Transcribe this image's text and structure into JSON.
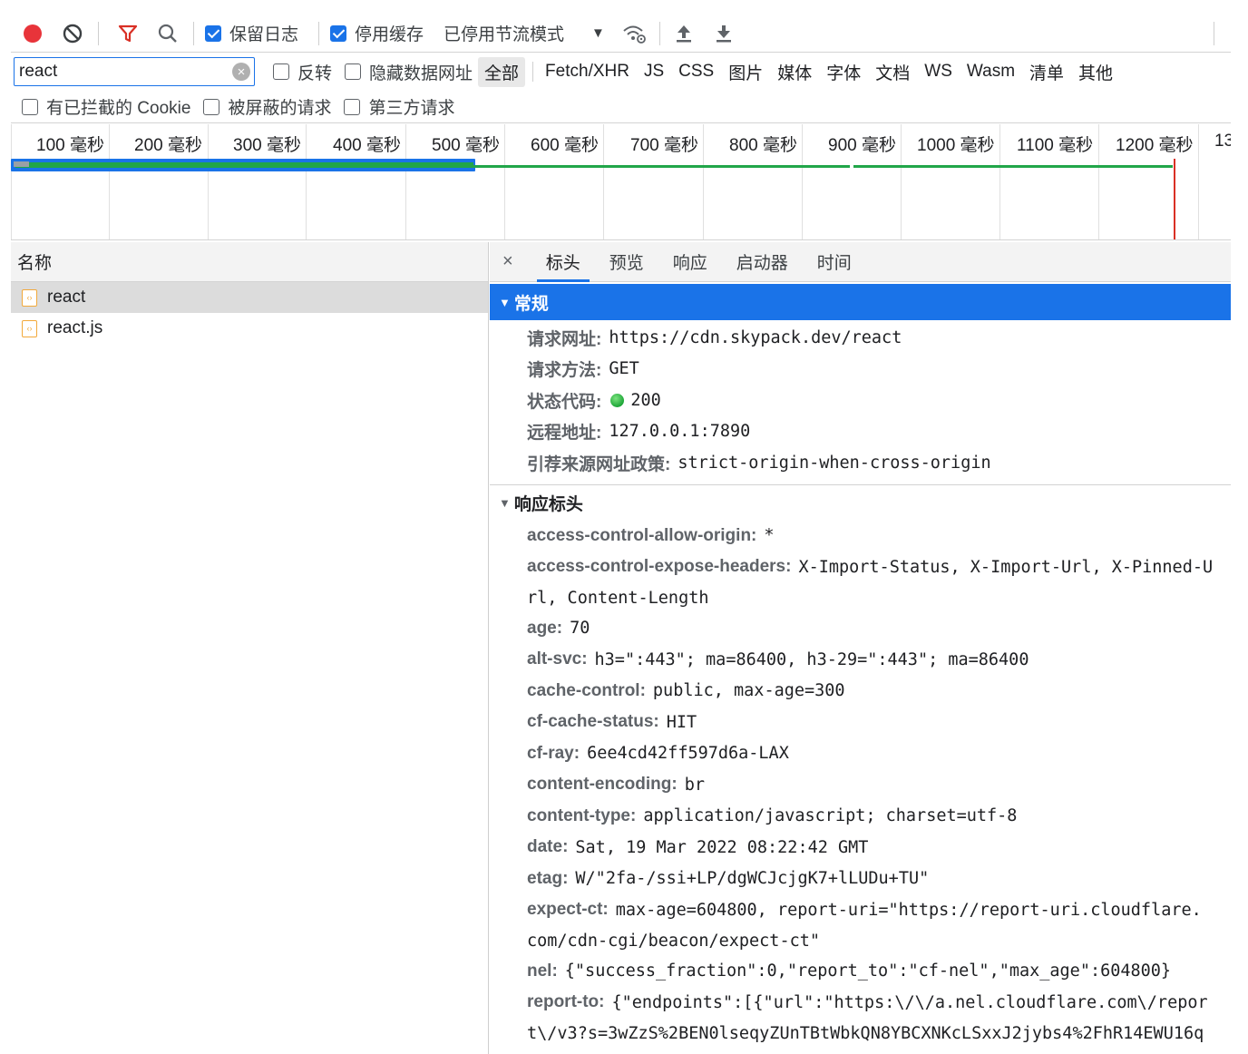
{
  "toolbar": {
    "preserve_log_label": "保留日志",
    "preserve_log_checked": true,
    "disable_cache_label": "停用缓存",
    "disable_cache_checked": true,
    "throttle_value": "已停用节流模式"
  },
  "filter": {
    "query": "react",
    "invert_label": "反转",
    "hide_data_urls_label": "隐藏数据网址",
    "types": [
      "全部",
      "Fetch/XHR",
      "JS",
      "CSS",
      "图片",
      "媒体",
      "字体",
      "文档",
      "WS",
      "Wasm",
      "清单",
      "其他"
    ],
    "active_type": "全部",
    "blocked_cookies_label": "有已拦截的 Cookie",
    "blocked_requests_label": "被屏蔽的请求",
    "third_party_label": "第三方请求"
  },
  "timeline": {
    "ticks": [
      "100 毫秒",
      "200 毫秒",
      "300 毫秒",
      "400 毫秒",
      "500 毫秒",
      "600 毫秒",
      "700 毫秒",
      "800 毫秒",
      "900 毫秒",
      "1000 毫秒",
      "1100 毫秒",
      "1200 毫秒",
      "13"
    ]
  },
  "requests": {
    "column_name": "名称",
    "items": [
      {
        "name": "react",
        "selected": true
      },
      {
        "name": "react.js",
        "selected": false
      }
    ]
  },
  "details": {
    "close": "×",
    "tabs": [
      "标头",
      "预览",
      "响应",
      "启动器",
      "时间"
    ],
    "active_tab": "标头",
    "general": {
      "title": "常规",
      "rows": [
        {
          "key": "请求网址:",
          "value": "https://cdn.skypack.dev/react"
        },
        {
          "key": "请求方法:",
          "value": "GET"
        },
        {
          "key": "状态代码:",
          "value": "200"
        },
        {
          "key": "远程地址:",
          "value": "127.0.0.1:7890"
        },
        {
          "key": "引荐来源网址政策:",
          "value": "strict-origin-when-cross-origin"
        }
      ]
    },
    "response_headers": {
      "title": "响应标头",
      "rows": [
        {
          "key": "access-control-allow-origin:",
          "value": "*"
        },
        {
          "key": "access-control-expose-headers:",
          "value": "X-Import-Status, X-Import-Url, X-Pinned-U",
          "cont": "rl, Content-Length"
        },
        {
          "key": "age:",
          "value": "70"
        },
        {
          "key": "alt-svc:",
          "value": "h3=\":443\"; ma=86400, h3-29=\":443\"; ma=86400"
        },
        {
          "key": "cache-control:",
          "value": "public, max-age=300"
        },
        {
          "key": "cf-cache-status:",
          "value": "HIT"
        },
        {
          "key": "cf-ray:",
          "value": "6ee4cd42ff597d6a-LAX"
        },
        {
          "key": "content-encoding:",
          "value": "br"
        },
        {
          "key": "content-type:",
          "value": "application/javascript; charset=utf-8"
        },
        {
          "key": "date:",
          "value": "Sat, 19 Mar 2022 08:22:42 GMT"
        },
        {
          "key": "etag:",
          "value": "W/\"2fa-/ssi+LP/dgWCJcjgK7+lLUDu+TU\""
        },
        {
          "key": "expect-ct:",
          "value": "max-age=604800, report-uri=\"https://report-uri.cloudflare.",
          "cont": "com/cdn-cgi/beacon/expect-ct\""
        },
        {
          "key": "nel:",
          "value": "{\"success_fraction\":0,\"report_to\":\"cf-nel\",\"max_age\":604800}"
        },
        {
          "key": "report-to:",
          "value": "{\"endpoints\":[{\"url\":\"https:\\/\\/a.nel.cloudflare.com\\/repor",
          "cont": "t\\/v3?s=3wZzS%2BEN0lseqyZUnTBtWbkQN8YBCXNKcLSxxJ2jybs4%2FhR14EWU16q"
        }
      ]
    }
  },
  "colors": {
    "accent": "#1a73e8",
    "record": "#e8343a",
    "filter": "#d93025",
    "waterfall_green": "#21a649",
    "status_ok": "#1ea638"
  },
  "icons": [
    "record-icon",
    "clear-icon",
    "filter-icon",
    "search-icon",
    "throttle-dropdown-icon",
    "network-conditions-icon",
    "import-har-icon",
    "export-har-icon"
  ]
}
